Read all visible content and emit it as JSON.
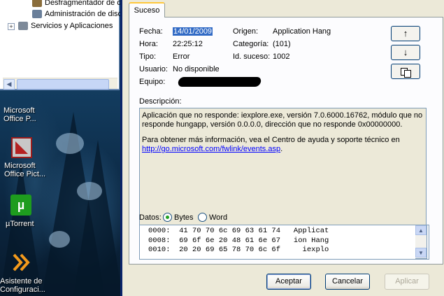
{
  "explorer_tree": {
    "items": [
      {
        "label": "Desfragmentador de d"
      },
      {
        "label": "Administración de disc"
      },
      {
        "label": "Servicios y Aplicaciones"
      }
    ]
  },
  "desktop_icons": [
    {
      "label_lines": [
        "Microsoft",
        "Office P..."
      ],
      "icon": "office-icon"
    },
    {
      "label_lines": [
        "Microsoft",
        "Office Pict..."
      ],
      "icon": "office-picture-manager-icon"
    },
    {
      "label_lines": [
        "µTorrent"
      ],
      "icon": "utorrent-icon"
    },
    {
      "label_lines": [
        "Asistente de",
        "Configuraci..."
      ],
      "icon": "wizard-arrows-icon"
    }
  ],
  "dialog": {
    "tab_label": "Suceso",
    "fields": {
      "fecha_label": "Fecha:",
      "fecha_value": "14/01/2009",
      "hora_label": "Hora:",
      "hora_value": "22:25:12",
      "tipo_label": "Tipo:",
      "tipo_value": "Error",
      "usuario_label": "Usuario:",
      "usuario_value": "No disponible",
      "equipo_label": "Equipo:",
      "origen_label": "Origen:",
      "origen_value": "Application Hang",
      "categoria_label": "Categoría:",
      "categoria_value": "(101)",
      "id_label": "Id. suceso:",
      "id_value": "1002"
    },
    "nav_buttons": {
      "up_icon": "↑",
      "down_icon": "↓"
    },
    "description_label": "Descripción:",
    "description_p1": "Aplicación que no responde: iexplore.exe, versión 7.0.6000.16762, módulo que no responde hungapp, versión 0.0.0.0, dirección que no responde 0x00000000.",
    "description_p2": "Para obtener más información, vea el Centro de ayuda y soporte técnico en",
    "description_link": "http://go.microsoft.com/fwlink/events.asp",
    "description_link_suffix": ".",
    "data_label": "Datos:",
    "radio_bytes": "Bytes",
    "radio_word": "Word",
    "selected_format": "Bytes",
    "hex_lines": [
      "0000:  41 70 70 6c 69 63 61 74   Applicat",
      "0008:  69 6f 6e 20 48 61 6e 67   ion Hang",
      "0010:  20 20 69 65 78 70 6c 6f     iexplo"
    ],
    "buttons": {
      "ok": "Aceptar",
      "cancel": "Cancelar",
      "apply": "Aplicar"
    }
  }
}
